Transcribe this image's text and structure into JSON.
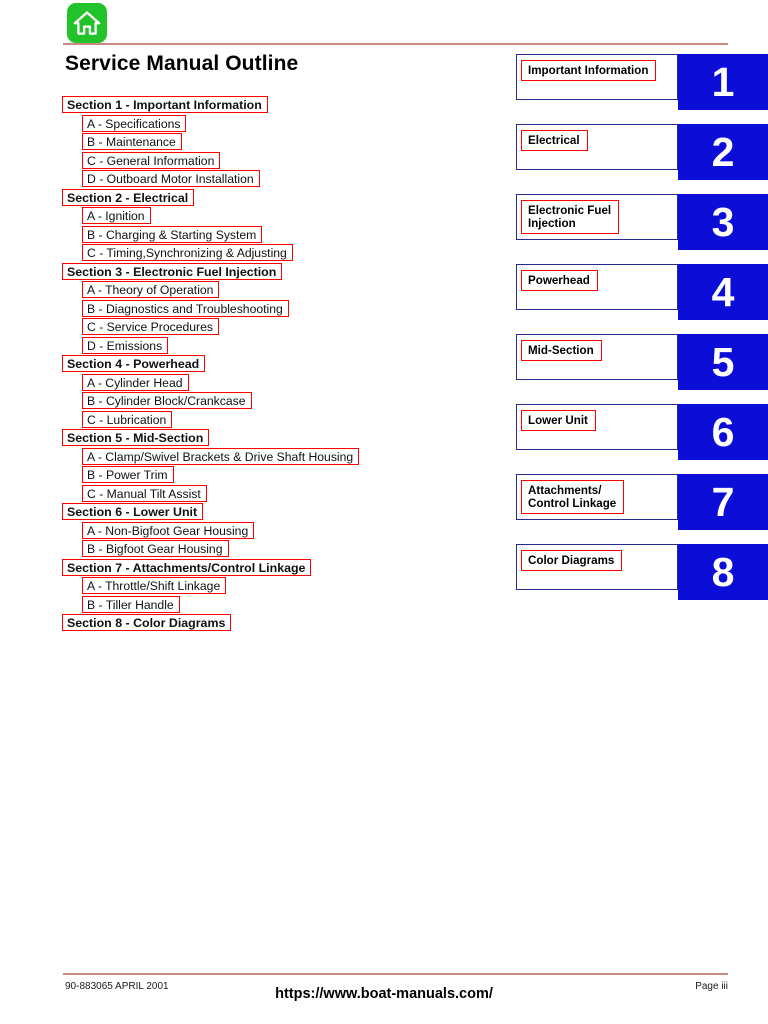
{
  "header": {
    "home_icon": "home-icon",
    "title": "Service Manual Outline",
    "rule_color": "#C98A86"
  },
  "colors": {
    "outline_box_border": "#FF0000",
    "tab_panel_border": "#2B2B8F",
    "tab_number_bg": "#0D0DD8",
    "tab_number_text": "#FFFFFF",
    "home_icon_bg": "#22C32A",
    "rule": "#C98A86"
  },
  "outline": [
    {
      "type": "section",
      "label": "Section 1 - Important Information"
    },
    {
      "type": "sub",
      "label": "A - Specifications"
    },
    {
      "type": "sub",
      "label": "B - Maintenance"
    },
    {
      "type": "sub",
      "label": "C - General Information"
    },
    {
      "type": "sub",
      "label": "D - Outboard Motor Installation"
    },
    {
      "type": "section",
      "label": "Section 2 - Electrical"
    },
    {
      "type": "sub",
      "label": "A - Ignition"
    },
    {
      "type": "sub",
      "label": "B - Charging & Starting System"
    },
    {
      "type": "sub",
      "label": "C - Timing,Synchronizing & Adjusting"
    },
    {
      "type": "section",
      "label": "Section 3 - Electronic Fuel Injection"
    },
    {
      "type": "sub",
      "label": "A - Theory of Operation"
    },
    {
      "type": "sub",
      "label": "B - Diagnostics and Troubleshooting"
    },
    {
      "type": "sub",
      "label": "C - Service Procedures"
    },
    {
      "type": "sub",
      "label": "D - Emissions"
    },
    {
      "type": "section",
      "label": "Section 4 - Powerhead"
    },
    {
      "type": "sub",
      "label": "A - Cylinder Head"
    },
    {
      "type": "sub",
      "label": "B - Cylinder Block/Crankcase"
    },
    {
      "type": "sub",
      "label": "C - Lubrication"
    },
    {
      "type": "section",
      "label": "Section 5 - Mid-Section"
    },
    {
      "type": "sub",
      "label": "A - Clamp/Swivel Brackets & Drive Shaft Housing"
    },
    {
      "type": "sub",
      "label": "B - Power Trim"
    },
    {
      "type": "sub",
      "label": "C - Manual Tilt Assist"
    },
    {
      "type": "section",
      "label": "Section 6 - Lower Unit"
    },
    {
      "type": "sub",
      "label": "A - Non-Bigfoot Gear Housing"
    },
    {
      "type": "sub",
      "label": "B - Bigfoot Gear Housing"
    },
    {
      "type": "section",
      "label": "Section 7 - Attachments/Control Linkage"
    },
    {
      "type": "sub",
      "label": "A - Throttle/Shift Linkage"
    },
    {
      "type": "sub",
      "label": "B - Tiller Handle"
    },
    {
      "type": "section",
      "label": "Section 8 - Color Diagrams"
    }
  ],
  "tabs": [
    {
      "number": "1",
      "label": "Important Information"
    },
    {
      "number": "2",
      "label": "Electrical"
    },
    {
      "number": "3",
      "label": "Electronic Fuel\nInjection"
    },
    {
      "number": "4",
      "label": "Powerhead"
    },
    {
      "number": "5",
      "label": "Mid-Section"
    },
    {
      "number": "6",
      "label": "Lower Unit"
    },
    {
      "number": "7",
      "label": "Attachments/\nControl Linkage"
    },
    {
      "number": "8",
      "label": "Color Diagrams"
    }
  ],
  "footer": {
    "left": "90-883065   APRIL  2001",
    "center": "https://www.boat-manuals.com/",
    "right": "Page iii"
  }
}
